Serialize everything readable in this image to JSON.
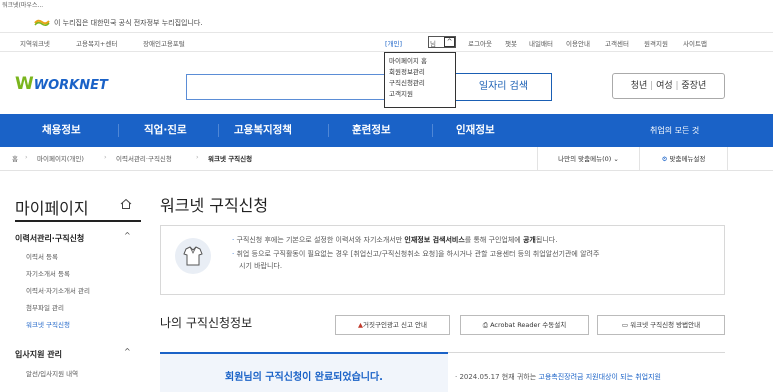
{
  "page_title": "워크넷(마우스...",
  "gov_banner": {
    "text": "이 누리집은 대한민국 공식 전자정부 누리집입니다."
  },
  "util": {
    "left_links": [
      "지역워크넷",
      "고용복지+센터",
      "장애인고용포털"
    ],
    "user_label": "[개인]",
    "user_name": "님",
    "right_links": [
      "로그아웃",
      "챗봇",
      "내일배터",
      "이용안내",
      "고객센터",
      "원격지원",
      "사이트맵"
    ]
  },
  "mypage_dropdown": [
    "마이페이지 홈",
    "회원정보관리",
    "구직신청관리",
    "고객지원"
  ],
  "header": {
    "logo_text": "WORKNET",
    "search_button": "일자리 검색",
    "age_groups": [
      "청년",
      "여성",
      "중장년"
    ]
  },
  "gnb": [
    "채용정보",
    "직업·진로",
    "고용복지정책",
    "훈련정보",
    "인재정보",
    "취업의 모든 것"
  ],
  "breadcrumb": [
    "홈",
    "마이페이지(개인)",
    "이력서관리·구직신청",
    "워크넷 구직신청"
  ],
  "quick": {
    "my_menu": "나만의 맞춤메뉴(0)",
    "settings": "맞춤메뉴설정"
  },
  "sidebar": {
    "title": "마이페이지",
    "groups": [
      {
        "label": "이력서관리·구직신청",
        "items": [
          "이력서 등록",
          "자기소개서 등록",
          "이력서·자기소개서 관리",
          "첨부파일 관리",
          "워크넷 구직신청"
        ]
      },
      {
        "label": "입사지원 관리",
        "items": [
          "알선/입사지원 내역"
        ]
      }
    ]
  },
  "main": {
    "title": "워크넷 구직신청",
    "notices": [
      {
        "pre": "구직신청 후에는 기본으로 설정한 이력서와 자기소개서만 ",
        "bold": "인재정보 검색서비스",
        "mid": "를 통해 구인업체에 ",
        "bold2": "공개",
        "post": "됩니다."
      },
      {
        "line1": "취업 등으로 구직활동이 필요없는 경우 [취업신고/구직신청취소 요청]을 하시거나 관할 고용센터 등의 취업알선기관에 알려주",
        "line2": "시기 바랍니다."
      }
    ],
    "sub_title": "나의 구직신청정보",
    "buttons": [
      "거짓구인광고 신고 안내",
      "Acrobat Reader 수동설치",
      "워크넷 구직신청 방법안내"
    ],
    "done_text": "회원님의 구직신청이 완료되었습니다.",
    "right_note_pre": "· 2024.05.17 현재 귀하는 ",
    "right_note_hl": "고용촉진장려금 지원대상이 되는 취업지원"
  },
  "colors": {
    "brand_blue": "#1a62c7",
    "logo_green": "#7ab51d",
    "gov_orange": "#e8a317"
  }
}
